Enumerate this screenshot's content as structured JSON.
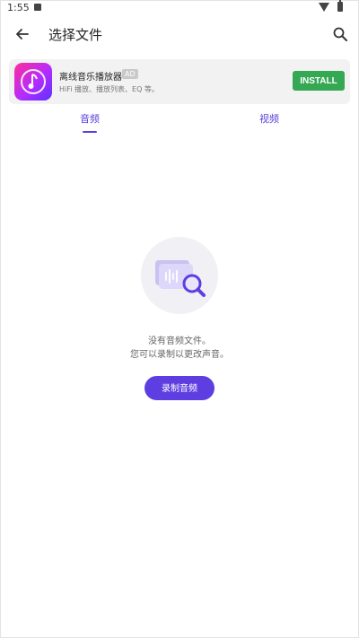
{
  "status_bar": {
    "time": "1:55"
  },
  "app_bar": {
    "title": "选择文件"
  },
  "ad": {
    "title": "离线音乐播放器",
    "badge": "AD",
    "description": "HiFi 播放、播放列表、EQ 等。",
    "install_label": "INSTALL",
    "install_color": "#35a853"
  },
  "tabs": [
    {
      "label": "音频",
      "selected": true
    },
    {
      "label": "视频",
      "selected": false
    }
  ],
  "empty_state": {
    "line1": "没有音频文件。",
    "line2": "您可以录制以更改声音。",
    "button_label": "录制音频"
  },
  "colors": {
    "accent": "#5e3ee0"
  }
}
